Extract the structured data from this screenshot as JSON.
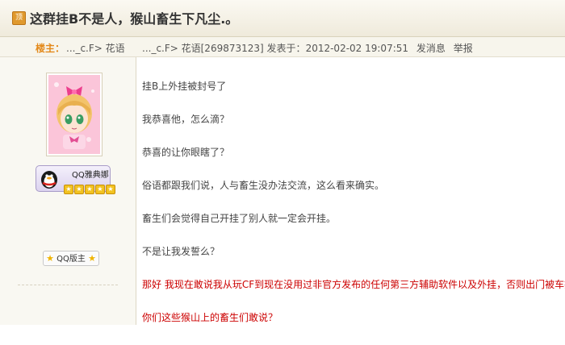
{
  "thread": {
    "icon_label": "顶",
    "title": "这群挂B不是人，猴山畜生下凡尘.。"
  },
  "post": {
    "op_label": "楼主：",
    "author_name": "..._c.F> 花语",
    "author_full": "..._c.F> 花语[269873123]",
    "posted_at_label": "发表于：",
    "posted_at": "2012-02-02 19:07:51",
    "message_link": "发消息",
    "report_link": "举报"
  },
  "user": {
    "badge_text": "QQ雅典娜",
    "badge_stars": 5,
    "rank": "QQ版主"
  },
  "content": {
    "lines": [
      {
        "text": "挂B上外挂被封号了",
        "color": "#444444"
      },
      {
        "text": "我恭喜他，怎么滴？",
        "color": "#444444"
      },
      {
        "text": "恭喜的让你眼瞎了？",
        "color": "#444444"
      },
      {
        "text": "俗语都跟我们说，人与畜生没办法交流，这么看来确实。",
        "color": "#444444"
      },
      {
        "text": "畜生们会觉得自己开挂了别人就一定会开挂。",
        "color": "#444444"
      },
      {
        "text": "不是让我发誓么？",
        "color": "#444444"
      },
      {
        "text": "那好 我现在敢说我从玩CF到现在没用过非官方发布的任何第三方辅助软件以及外挂，否则出门被车撞死。",
        "color": "#cc0000"
      },
      {
        "text": "你们这些猴山上的畜生们敢说？",
        "color": "#cc0000"
      }
    ]
  }
}
